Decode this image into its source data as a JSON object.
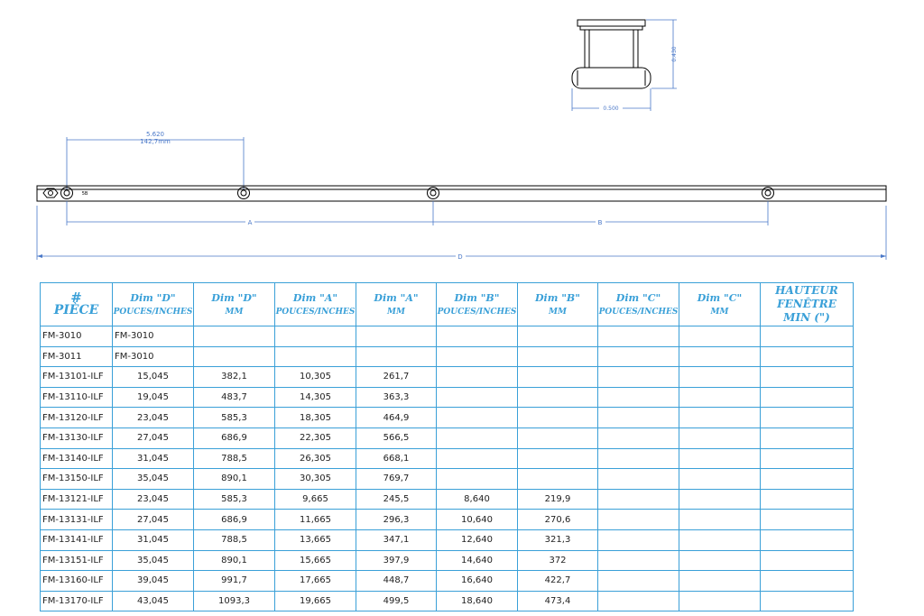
{
  "drawing": {
    "profile_width": "0.500",
    "profile_height": "0.430",
    "first_spacing_in": "5.620",
    "first_spacing_mm": "142,7mm",
    "label_a": "A",
    "label_b": "B",
    "label_d": "D",
    "end_label": "5B"
  },
  "table": {
    "headers": [
      {
        "line1": "#",
        "line2": "PIÈCE"
      },
      {
        "line1": "Dim \"D\"",
        "line2": "POUCES/INCHES"
      },
      {
        "line1": "Dim \"D\"",
        "line2": "MM"
      },
      {
        "line1": "Dim \"A\"",
        "line2": "POUCES/INCHES"
      },
      {
        "line1": "Dim \"A\"",
        "line2": "MM"
      },
      {
        "line1": "Dim \"B\"",
        "line2": "POUCES/INCHES"
      },
      {
        "line1": "Dim \"B\"",
        "line2": "MM"
      },
      {
        "line1": "Dim \"C\"",
        "line2": "POUCES/INCHES"
      },
      {
        "line1": "Dim \"C\"",
        "line2": "MM"
      },
      {
        "line1": "HAUTEUR",
        "line2": "FENÊTRE",
        "line3": "MIN (\")"
      }
    ],
    "rows": [
      [
        "FM-3010",
        "FM-3010",
        "",
        "",
        "",
        "",
        "",
        "",
        "",
        ""
      ],
      [
        "FM-3011",
        "FM-3010",
        "",
        "",
        "",
        "",
        "",
        "",
        "",
        ""
      ],
      [
        "FM-13101-ILF",
        "15,045",
        "382,1",
        "10,305",
        "261,7",
        "",
        "",
        "",
        "",
        ""
      ],
      [
        "FM-13110-ILF",
        "19,045",
        "483,7",
        "14,305",
        "363,3",
        "",
        "",
        "",
        "",
        ""
      ],
      [
        "FM-13120-ILF",
        "23,045",
        "585,3",
        "18,305",
        "464,9",
        "",
        "",
        "",
        "",
        ""
      ],
      [
        "FM-13130-ILF",
        "27,045",
        "686,9",
        "22,305",
        "566,5",
        "",
        "",
        "",
        "",
        ""
      ],
      [
        "FM-13140-ILF",
        "31,045",
        "788,5",
        "26,305",
        "668,1",
        "",
        "",
        "",
        "",
        ""
      ],
      [
        "FM-13150-ILF",
        "35,045",
        "890,1",
        "30,305",
        "769,7",
        "",
        "",
        "",
        "",
        ""
      ],
      [
        "FM-13121-ILF",
        "23,045",
        "585,3",
        "9,665",
        "245,5",
        "8,640",
        "219,9",
        "",
        "",
        ""
      ],
      [
        "FM-13131-ILF",
        "27,045",
        "686,9",
        "11,665",
        "296,3",
        "10,640",
        "270,6",
        "",
        "",
        ""
      ],
      [
        "FM-13141-ILF",
        "31,045",
        "788,5",
        "13,665",
        "347,1",
        "12,640",
        "321,3",
        "",
        "",
        ""
      ],
      [
        "FM-13151-ILF",
        "35,045",
        "890,1",
        "15,665",
        "397,9",
        "14,640",
        "372",
        "",
        "",
        ""
      ],
      [
        "FM-13160-ILF",
        "39,045",
        "991,7",
        "17,665",
        "448,7",
        "16,640",
        "422,7",
        "",
        "",
        ""
      ],
      [
        "FM-13170-ILF",
        "43,045",
        "1093,3",
        "19,665",
        "499,5",
        "18,640",
        "473,4",
        "",
        "",
        ""
      ]
    ]
  }
}
